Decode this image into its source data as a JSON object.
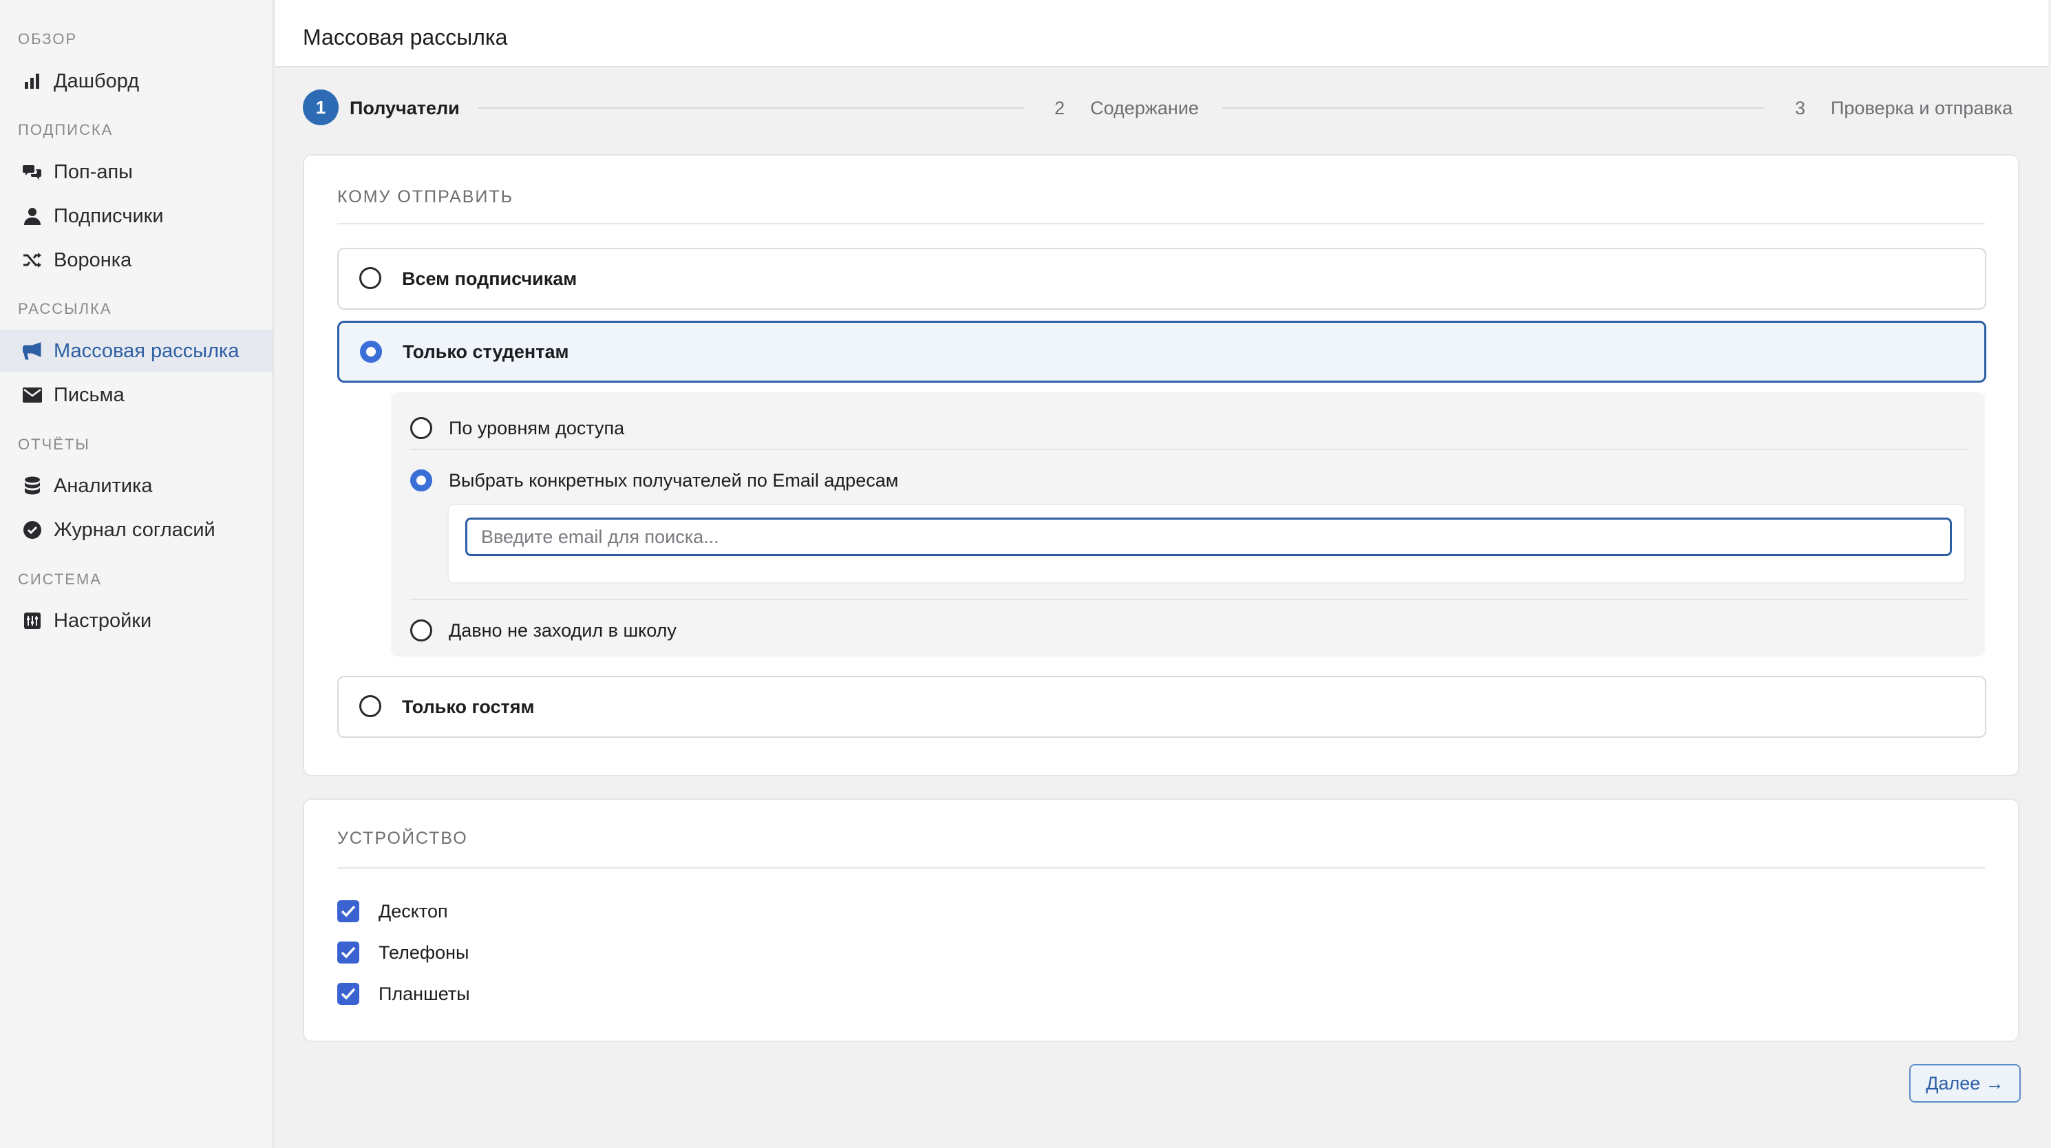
{
  "sidebar": {
    "sections": [
      {
        "title": "ОБЗОР",
        "items": [
          {
            "label": "Дашборд",
            "icon": "bar-chart-icon"
          }
        ]
      },
      {
        "title": "ПОДПИСКА",
        "items": [
          {
            "label": "Поп-апы",
            "icon": "chat-bubbles-icon"
          },
          {
            "label": "Подписчики",
            "icon": "user-icon"
          },
          {
            "label": "Воронка",
            "icon": "shuffle-icon"
          }
        ]
      },
      {
        "title": "РАССЫЛКА",
        "items": [
          {
            "label": "Массовая рассылка",
            "icon": "megaphone-icon",
            "active": true
          },
          {
            "label": "Письма",
            "icon": "envelope-icon"
          }
        ]
      },
      {
        "title": "ОТЧЁТЫ",
        "items": [
          {
            "label": "Аналитика",
            "icon": "database-icon"
          },
          {
            "label": "Журнал согласий",
            "icon": "check-circle-icon"
          }
        ]
      },
      {
        "title": "СИСТЕМА",
        "items": [
          {
            "label": "Настройки",
            "icon": "settings-icon"
          }
        ]
      }
    ]
  },
  "header": {
    "title": "Массовая рассылка"
  },
  "stepper": {
    "steps": [
      {
        "num": "1",
        "label": "Получатели",
        "active": true
      },
      {
        "num": "2",
        "label": "Содержание"
      },
      {
        "num": "3",
        "label": "Проверка и отправка"
      }
    ]
  },
  "recipients": {
    "title": "КОМУ ОТПРАВИТЬ",
    "options": [
      {
        "label": "Всем подписчикам",
        "selected": false
      },
      {
        "label": "Только студентам",
        "selected": true
      },
      {
        "label": "Только гостям",
        "selected": false
      }
    ],
    "sub_options": [
      {
        "label": "По уровням доступа",
        "selected": false
      },
      {
        "label": "Выбрать конкретных получателей по Email адресам",
        "selected": true
      },
      {
        "label": "Давно не заходил в школу",
        "selected": false
      }
    ],
    "email_search": {
      "placeholder": "Введите email для поиска...",
      "value": ""
    }
  },
  "device": {
    "title": "УСТРОЙСТВО",
    "items": [
      {
        "label": "Десктоп",
        "checked": true
      },
      {
        "label": "Телефоны",
        "checked": true
      },
      {
        "label": "Планшеты",
        "checked": true
      }
    ]
  },
  "actions": {
    "next_label": "Далее →"
  },
  "colors": {
    "accent": "#2d5fa4",
    "radio_on": "#3a6fd8",
    "checkbox": "#3a63d1"
  }
}
